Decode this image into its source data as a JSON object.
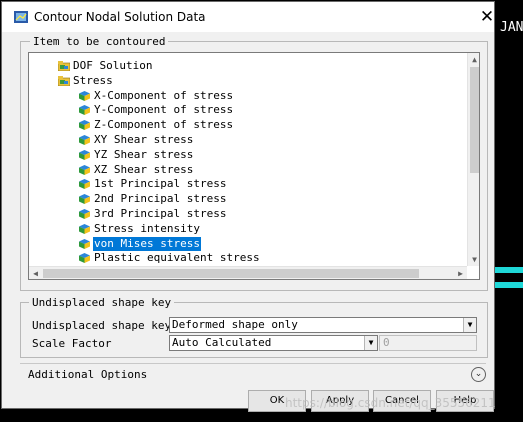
{
  "background": {
    "right_text": "JAN"
  },
  "watermark": "https://blog.csdn.net/qq_35556211",
  "dialog": {
    "title": "Contour Nodal Solution Data",
    "close_glyph": "✕"
  },
  "item_group": {
    "label": "Item to be contoured",
    "tree": [
      {
        "label": "DOF Solution",
        "icon": "folder-icon",
        "level": 0
      },
      {
        "label": "Stress",
        "icon": "folder-open-icon",
        "level": 0
      },
      {
        "label": "X-Component of stress",
        "icon": "cube-icon",
        "level": 1
      },
      {
        "label": "Y-Component of stress",
        "icon": "cube-icon",
        "level": 1
      },
      {
        "label": "Z-Component of stress",
        "icon": "cube-icon",
        "level": 1
      },
      {
        "label": "XY Shear stress",
        "icon": "cube-icon",
        "level": 1
      },
      {
        "label": "YZ Shear stress",
        "icon": "cube-icon",
        "level": 1
      },
      {
        "label": "XZ Shear stress",
        "icon": "cube-icon",
        "level": 1
      },
      {
        "label": "1st Principal stress",
        "icon": "cube-icon",
        "level": 1
      },
      {
        "label": "2nd Principal stress",
        "icon": "cube-icon",
        "level": 1
      },
      {
        "label": "3rd Principal stress",
        "icon": "cube-icon",
        "level": 1
      },
      {
        "label": "Stress intensity",
        "icon": "cube-icon",
        "level": 1
      },
      {
        "label": "von Mises stress",
        "icon": "cube-icon",
        "level": 1,
        "selected": true
      },
      {
        "label": "Plastic equivalent stress",
        "icon": "cube-icon",
        "level": 1
      }
    ]
  },
  "undisplaced_group": {
    "label": "Undisplaced shape key",
    "shape_key": {
      "label": "Undisplaced shape key",
      "value": "Deformed shape only"
    },
    "scale_factor": {
      "label": "Scale Factor",
      "value": "Auto Calculated",
      "extra_value": "0"
    }
  },
  "additional_options": {
    "label": "Additional Options"
  },
  "buttons": {
    "ok": "OK",
    "apply": "Apply",
    "cancel": "Cancel",
    "help": "Help"
  },
  "colors": {
    "selection": "#0078d7",
    "cube_top": "#2c86d9",
    "cube_side": "#2e9a3a",
    "cube_front": "#f2c21b",
    "folder": "#e8c23c",
    "screen_bg": "#000000",
    "screen_band": "#1fd8d8"
  }
}
